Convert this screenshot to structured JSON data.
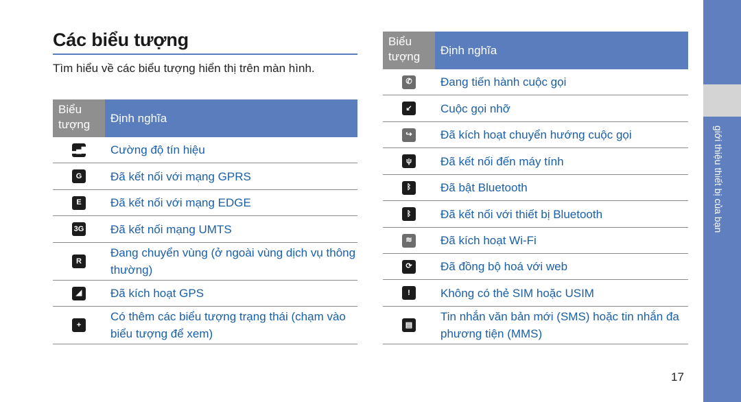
{
  "page": {
    "title": "Các biểu tượng",
    "intro": "Tìm hiểu về các biểu tượng hiển thị trên màn hình.",
    "page_number": "17",
    "side_tab_label": "giới thiệu thiết bị của bạn"
  },
  "table_header": {
    "col1": "Biểu tượng",
    "col2": "Định nghĩa"
  },
  "left_table": [
    {
      "icon": "signal-strength-icon",
      "glyph": "▂▄▆",
      "text": "Cường độ tín hiệu"
    },
    {
      "icon": "gprs-icon",
      "glyph": "G",
      "text": "Đã kết nối với mạng GPRS"
    },
    {
      "icon": "edge-icon",
      "glyph": "E",
      "text": "Đã kết nối với mạng EDGE"
    },
    {
      "icon": "umts-3g-icon",
      "glyph": "3G",
      "text": "Đã kết nối mạng UMTS"
    },
    {
      "icon": "roaming-icon",
      "glyph": "R",
      "text": "Đang chuyển vùng (ở ngoài vùng dịch vụ thông thường)"
    },
    {
      "icon": "gps-icon",
      "glyph": "◢",
      "text": "Đã kích hoạt GPS"
    },
    {
      "icon": "more-status-icon",
      "glyph": "+",
      "text": "Có thêm các biểu tượng trạng thái (chạm vào biểu tượng để xem)"
    }
  ],
  "right_table": [
    {
      "icon": "call-in-progress-icon",
      "glyph": "✆",
      "text": "Đang tiến hành cuộc gọi"
    },
    {
      "icon": "missed-call-icon",
      "glyph": "↙",
      "text": "Cuộc gọi nhỡ"
    },
    {
      "icon": "call-forwarding-icon",
      "glyph": "↪",
      "text": "Đã kích hoạt chuyển hướng cuộc gọi"
    },
    {
      "icon": "usb-icon",
      "glyph": "ψ",
      "text": "Đã kết nối đến máy tính"
    },
    {
      "icon": "bluetooth-icon",
      "glyph": "ᛒ",
      "text": "Đã bật Bluetooth"
    },
    {
      "icon": "bluetooth-connected-icon",
      "glyph": "ᛒ",
      "text": "Đã kết nối với thiết bị Bluetooth"
    },
    {
      "icon": "wifi-icon",
      "glyph": "≋",
      "text": "Đã kích hoạt Wi-Fi"
    },
    {
      "icon": "web-sync-icon",
      "glyph": "⟳",
      "text": "Đã đồng bộ hoá với web"
    },
    {
      "icon": "no-sim-icon",
      "glyph": "!",
      "text": "Không có thẻ SIM hoặc USIM"
    },
    {
      "icon": "new-message-icon",
      "glyph": "▤",
      "text": "Tin nhắn văn bản mới (SMS) hoặc tin nhắn đa phương tiện (MMS)"
    }
  ]
}
